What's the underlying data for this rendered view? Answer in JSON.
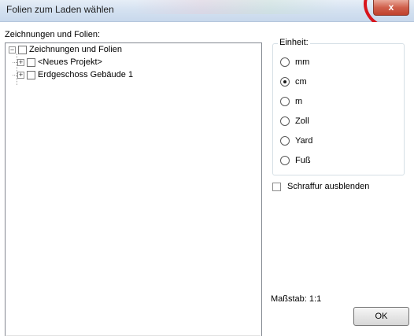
{
  "window": {
    "title": "Folien zum Laden wählen",
    "close_label": "x"
  },
  "tree": {
    "label": "Zeichnungen und Folien:",
    "root": {
      "label": "Zeichnungen und Folien",
      "expander": "−",
      "checked": false
    },
    "children": [
      {
        "label": "<Neues Projekt>",
        "expander": "+",
        "checked": false
      },
      {
        "label": "Erdgeschoss Gebäude 1",
        "expander": "+",
        "checked": false
      }
    ],
    "scrollbar": {
      "left_arrow": "◂",
      "right_arrow": "▸",
      "thumb_grip": "|||"
    }
  },
  "unit_group": {
    "legend": "Einheit:",
    "options": [
      "mm",
      "cm",
      "m",
      "Zoll",
      "Yard",
      "Fuß"
    ],
    "selected": "cm"
  },
  "hatch_checkbox": {
    "label": "Schraffur ausblenden",
    "checked": false
  },
  "scale_label": "Maßstab: 1:1",
  "ok_button": {
    "label": "OK"
  },
  "colors": {
    "highlight_ring": "#d8141c",
    "close_button": "#c0412c"
  }
}
